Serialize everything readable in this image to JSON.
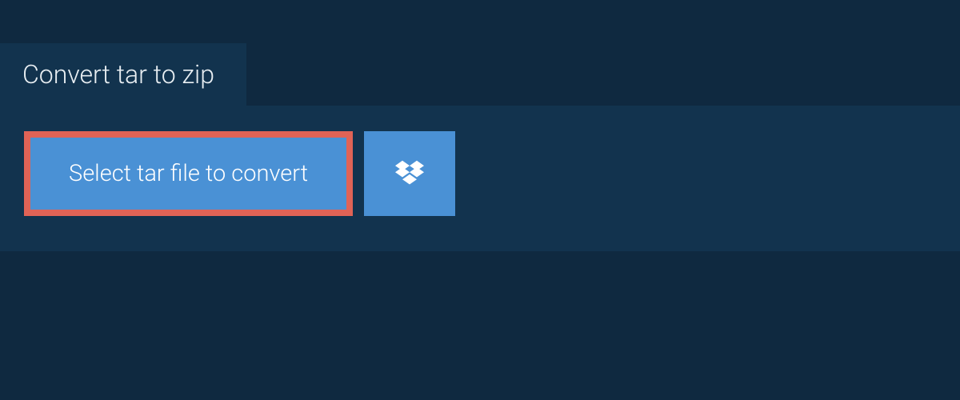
{
  "tab": {
    "title": "Convert tar to zip"
  },
  "actions": {
    "select_label": "Select tar file to convert"
  }
}
